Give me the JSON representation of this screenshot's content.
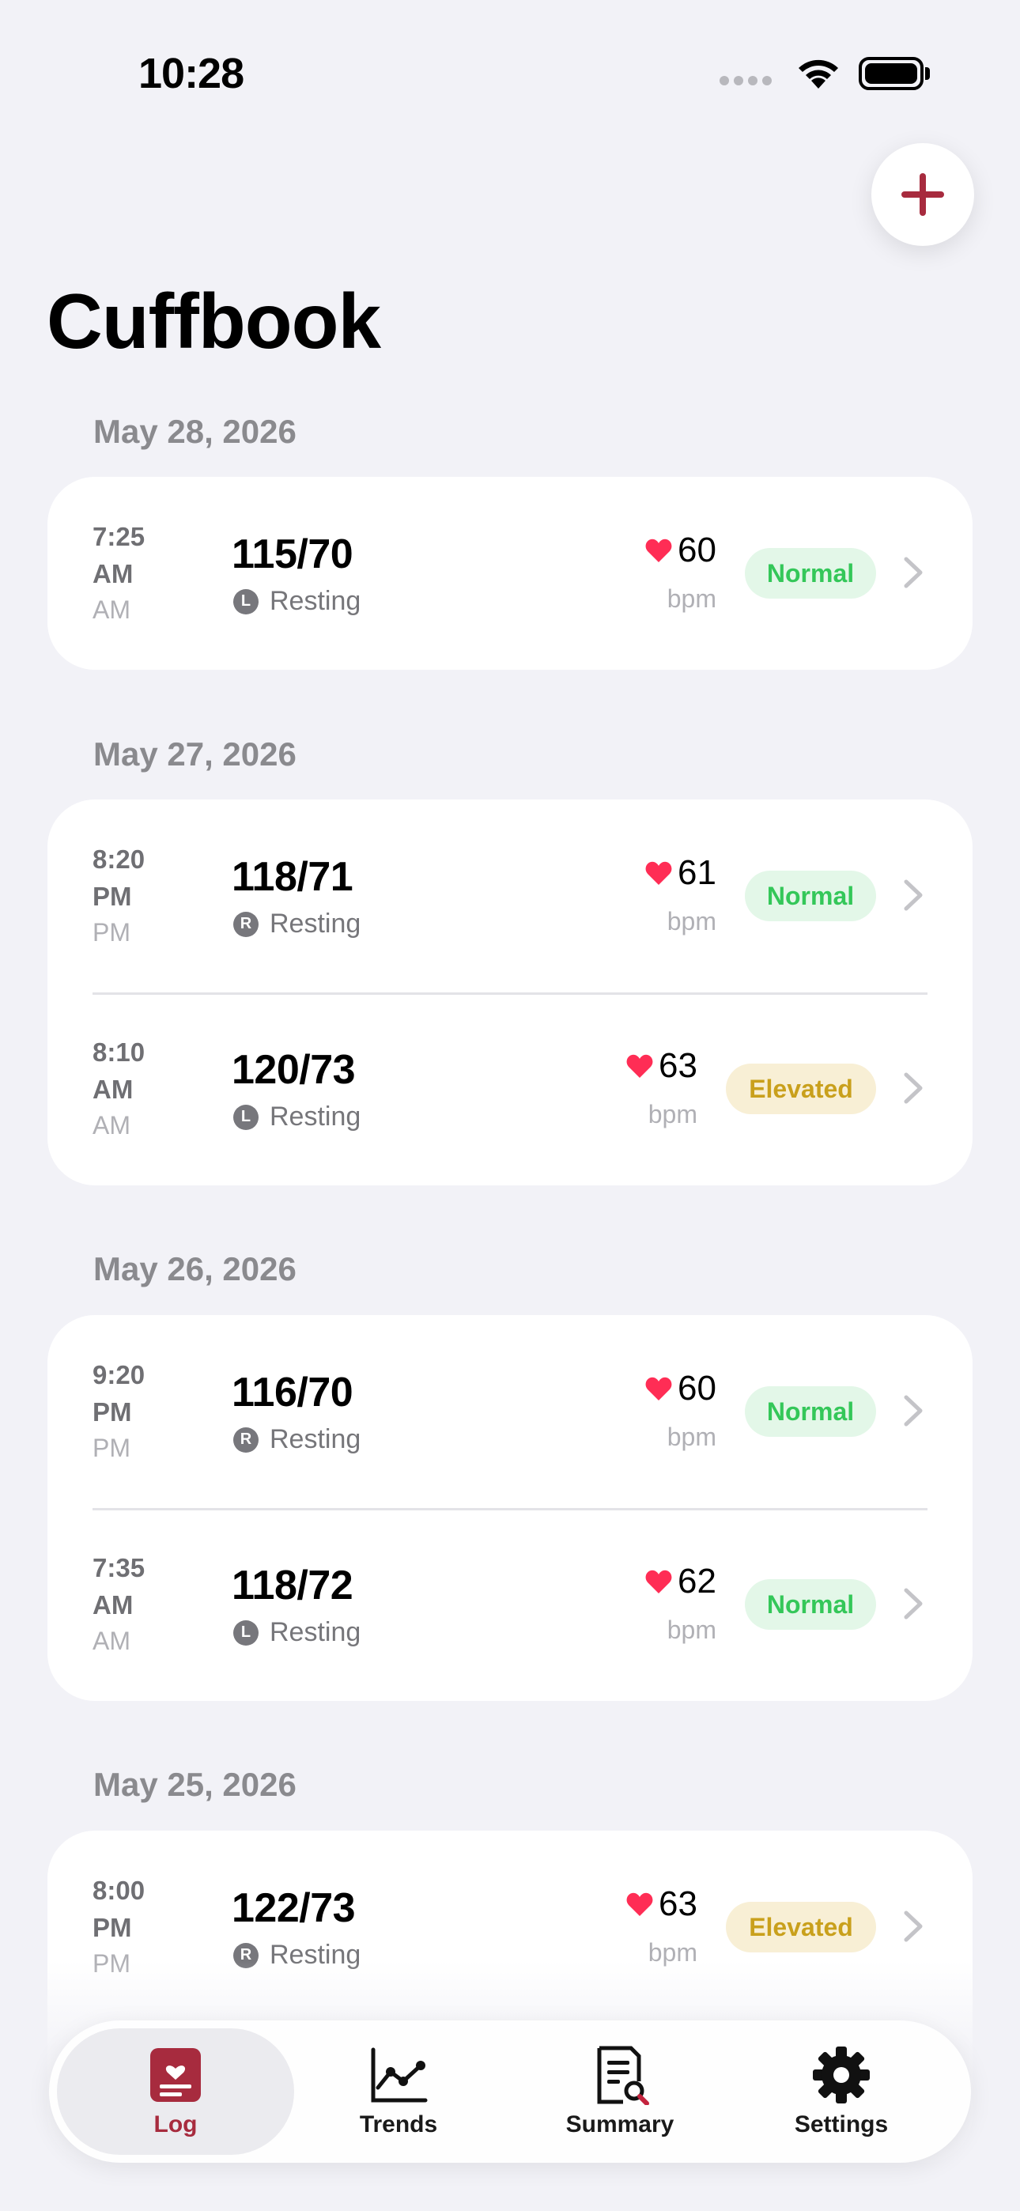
{
  "status_bar": {
    "time": "10:28"
  },
  "app": {
    "title": "Cuffbook",
    "accent_color": "#a72b3e"
  },
  "add_button": {
    "icon": "plus-icon"
  },
  "days": [
    {
      "date": "May 28, 2026",
      "readings": [
        {
          "time": "7:25 AM",
          "period": "AM",
          "bp": "115/70",
          "arm": "L",
          "context": "Resting",
          "pulse": "60",
          "unit": "bpm",
          "status": "Normal"
        }
      ]
    },
    {
      "date": "May 27, 2026",
      "readings": [
        {
          "time": "8:20 PM",
          "period": "PM",
          "bp": "118/71",
          "arm": "R",
          "context": "Resting",
          "pulse": "61",
          "unit": "bpm",
          "status": "Normal"
        },
        {
          "time": "8:10 AM",
          "period": "AM",
          "bp": "120/73",
          "arm": "L",
          "context": "Resting",
          "pulse": "63",
          "unit": "bpm",
          "status": "Elevated"
        }
      ]
    },
    {
      "date": "May 26, 2026",
      "readings": [
        {
          "time": "9:20 PM",
          "period": "PM",
          "bp": "116/70",
          "arm": "R",
          "context": "Resting",
          "pulse": "60",
          "unit": "bpm",
          "status": "Normal"
        },
        {
          "time": "7:35 AM",
          "period": "AM",
          "bp": "118/72",
          "arm": "L",
          "context": "Resting",
          "pulse": "62",
          "unit": "bpm",
          "status": "Normal"
        }
      ]
    },
    {
      "date": "May 25, 2026",
      "readings": [
        {
          "time": "8:00 PM",
          "period": "PM",
          "bp": "122/73",
          "arm": "R",
          "context": "Resting",
          "pulse": "63",
          "unit": "bpm",
          "status": "Elevated"
        }
      ]
    }
  ],
  "status_colors": {
    "Normal": "#34c759",
    "Elevated": "#c9a01c",
    "heart": "#ff2d55"
  },
  "tabs": [
    {
      "label": "Log",
      "icon": "log-icon",
      "active": true
    },
    {
      "label": "Trends",
      "icon": "trends-icon",
      "active": false
    },
    {
      "label": "Summary",
      "icon": "summary-icon",
      "active": false
    },
    {
      "label": "Settings",
      "icon": "gear-icon",
      "active": false
    }
  ]
}
